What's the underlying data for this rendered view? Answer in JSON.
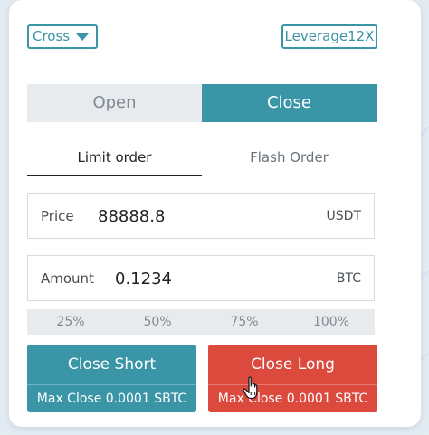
{
  "header": {
    "margin_mode": "Cross",
    "leverage": "Leverage12X"
  },
  "mode_tabs": {
    "open_label": "Open",
    "close_label": "Close",
    "active": "Close"
  },
  "order_tabs": {
    "limit_label": "Limit order",
    "flash_label": "Flash Order",
    "active": "Limit order"
  },
  "price_field": {
    "label": "Price",
    "value": "88888.8",
    "unit": "USDT"
  },
  "amount_field": {
    "label": "Amount",
    "value": "0.1234",
    "unit": "BTC"
  },
  "percent_options": [
    "25%",
    "50%",
    "75%",
    "100%"
  ],
  "actions": {
    "close_short_label": "Close Short",
    "close_short_sub": "Max Close 0.0001 SBTC",
    "close_long_label": "Close Long",
    "close_long_sub": "Max Close 0.0001 SBTC"
  },
  "icons": {
    "dropdown": "caret-down-icon",
    "pointer": "hand-pointer-icon"
  },
  "colors": {
    "accent": "#3a95a7",
    "danger": "#db4a3d",
    "muted_bg": "#e8ebee"
  }
}
